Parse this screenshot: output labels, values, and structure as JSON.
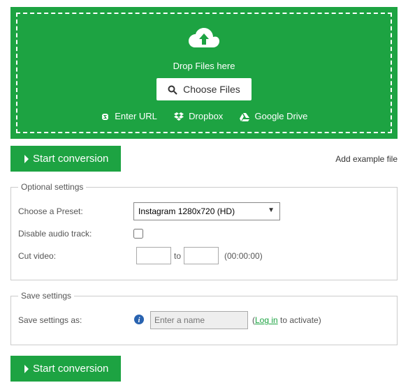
{
  "upload": {
    "drop_text": "Drop Files here",
    "choose_label": "Choose Files",
    "sources": {
      "url": "Enter URL",
      "dropbox": "Dropbox",
      "gdrive": "Google Drive"
    }
  },
  "start_label": "Start conversion",
  "example_link": "Add example file",
  "optional": {
    "legend": "Optional settings",
    "preset_label": "Choose a Preset:",
    "preset_value": "Instagram 1280x720 (HD)",
    "disable_audio_label": "Disable audio track:",
    "cut_label": "Cut video:",
    "cut_to": "to",
    "cut_hint": "(00:00:00)"
  },
  "save": {
    "legend": "Save settings",
    "label": "Save settings as:",
    "placeholder": "Enter a name",
    "login_prefix": "(",
    "login_link": "Log in",
    "login_suffix": " to activate)"
  }
}
